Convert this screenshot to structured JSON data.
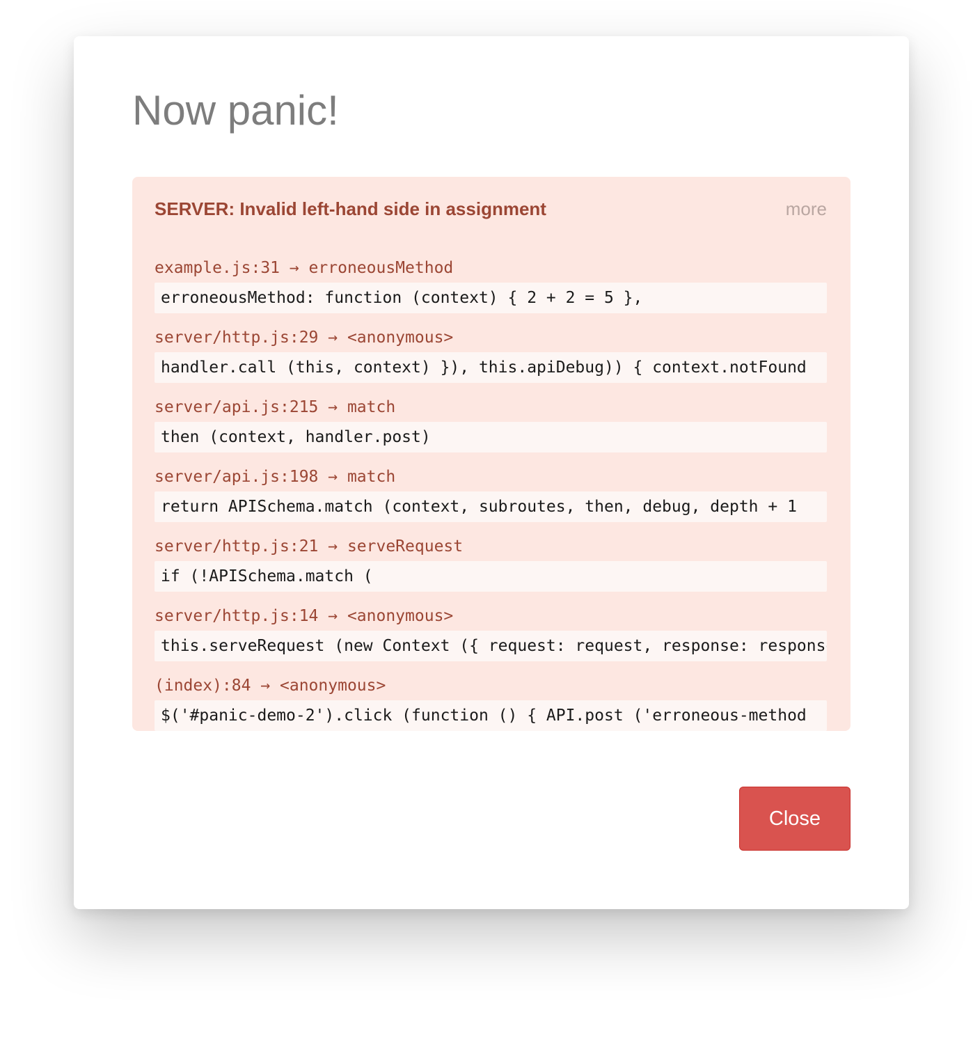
{
  "modal": {
    "title": "Now panic!",
    "close_label": "Close"
  },
  "error": {
    "message": "SERVER: Invalid left-hand side in assignment",
    "more_label": "more",
    "stack": [
      {
        "location": "example.js:31 → erroneousMethod",
        "code": "erroneousMethod: function (context) { 2 + 2 = 5 },"
      },
      {
        "location": "server/http.js:29 → <anonymous>",
        "code": "handler.call (this, context) }), this.apiDebug)) { context.notFound"
      },
      {
        "location": "server/api.js:215 → match",
        "code": "then (context, handler.post)"
      },
      {
        "location": "server/api.js:198 → match",
        "code": "return APISchema.match (context, subroutes, then, debug, depth + 1"
      },
      {
        "location": "server/http.js:21 → serveRequest",
        "code": "if (!APISchema.match ("
      },
      {
        "location": "server/http.js:14 → <anonymous>",
        "code": "this.serveRequest (new Context ({ request: request, response: response"
      },
      {
        "location": "(index):84 → <anonymous>",
        "code": "$('#panic-demo-2').click (function () { API.post ('erroneous-method"
      }
    ]
  },
  "colors": {
    "panel_background": "#fde7e1",
    "error_text": "#9b4634",
    "code_background": "#fdf6f4",
    "danger_button": "#d9534f"
  }
}
